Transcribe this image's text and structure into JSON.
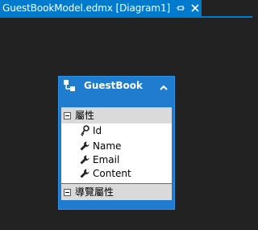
{
  "document_tab": {
    "title": "GuestBookModel.edmx [Diagram1]",
    "pin_icon": "pin-icon",
    "close_icon": "close-icon"
  },
  "colors": {
    "canvas_background": "#222222",
    "tab_accent": "#007acc",
    "entity_fill": "#1f7ccf",
    "section_header": "#dadada",
    "property_area": "#ffffff"
  },
  "entity": {
    "name": "GuestBook",
    "icon": "entity-type-icon",
    "collapse_icon": "chevron-up-icon",
    "properties_section": {
      "label": "屬性",
      "toggle_icon": "collapse-minus-icon",
      "items": [
        {
          "name": "Id",
          "icon": "key-icon"
        },
        {
          "name": "Name",
          "icon": "wrench-icon"
        },
        {
          "name": "Email",
          "icon": "wrench-icon"
        },
        {
          "name": "Content",
          "icon": "wrench-icon"
        }
      ]
    },
    "navigation_section": {
      "label": "導覽屬性",
      "toggle_icon": "collapse-minus-icon"
    }
  }
}
